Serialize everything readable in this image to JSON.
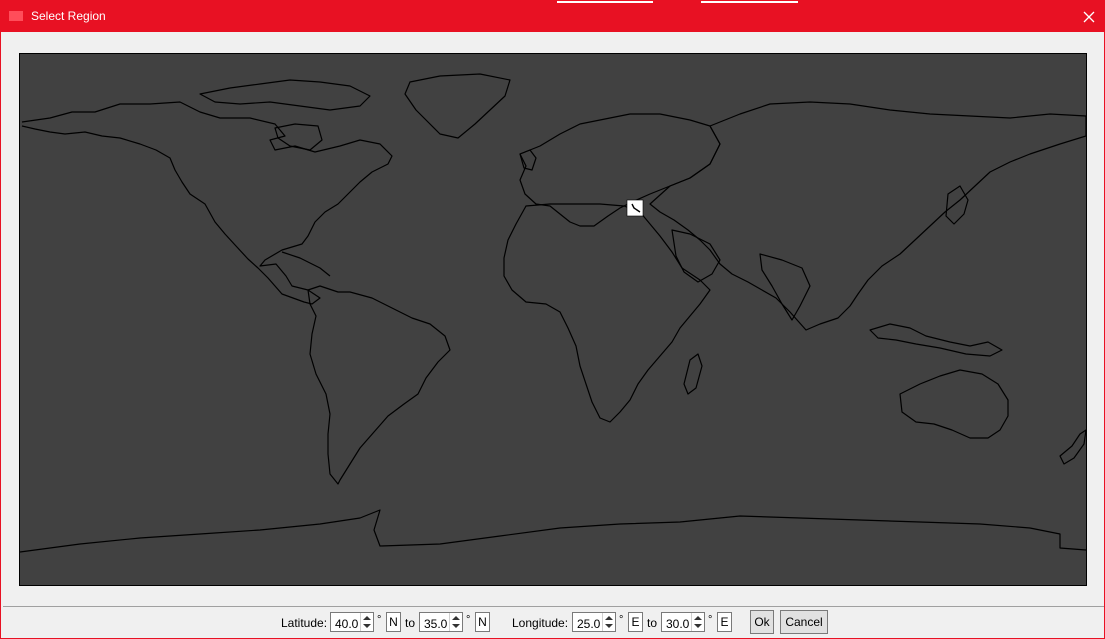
{
  "window": {
    "title": "Select Region",
    "accent_color": "#e81123"
  },
  "icons": {
    "app": "app-icon",
    "close": "close-icon",
    "selection": "selection-marker-icon"
  },
  "map": {
    "background": "#414141",
    "projection": "equirectangular",
    "selected_region": {
      "lat_from": 40.0,
      "lat_to": 35.0,
      "lon_from": 25.0,
      "lon_to": 30.0
    }
  },
  "footer": {
    "latitude_label": "Latitude:",
    "lat_from": "40.0",
    "lat_to": "35.0",
    "lat_from_hem": "N",
    "lat_to_hem": "N",
    "to_label": "to",
    "degree": "°",
    "longitude_label": "Longitude:",
    "lon_from": "25.0",
    "lon_to": "30.0",
    "lon_from_hem": "E",
    "lon_to_hem": "E",
    "ok_label": "Ok",
    "cancel_label": "Cancel"
  }
}
